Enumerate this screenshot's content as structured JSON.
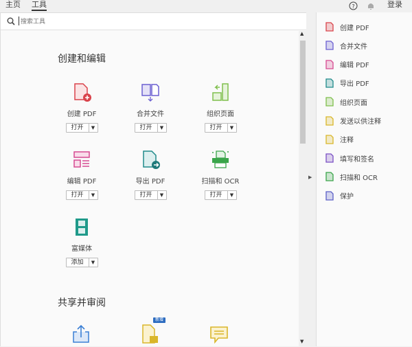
{
  "topbar": {
    "tabs": [
      {
        "label": "主页"
      },
      {
        "label": "工具"
      }
    ],
    "login": "登录"
  },
  "search": {
    "placeholder": "搜索工具"
  },
  "sections": [
    {
      "title": "创建和编辑",
      "tools": [
        {
          "label": "创建 PDF",
          "button": "打开",
          "color": "#d9434b"
        },
        {
          "label": "合并文件",
          "button": "打开",
          "color": "#6b5fd1"
        },
        {
          "label": "组织页面",
          "button": "打开",
          "color": "#7fbf4d"
        },
        {
          "label": "编辑 PDF",
          "button": "打开",
          "color": "#d64a91"
        },
        {
          "label": "导出 PDF",
          "button": "打开",
          "color": "#1f8a8a"
        },
        {
          "label": "扫描和 OCR",
          "button": "打开",
          "color": "#3aa54a"
        },
        {
          "label": "富媒体",
          "button": "添加",
          "color": "#1f9a8a"
        }
      ]
    },
    {
      "title": "共享并审阅",
      "badge": "新增",
      "tools": [
        {
          "color": "#3a7fd5"
        },
        {
          "color": "#d9b62a"
        },
        {
          "color": "#d9b62a"
        }
      ]
    }
  ],
  "sidebar": {
    "items": [
      {
        "label": "创建 PDF",
        "color": "#d9434b"
      },
      {
        "label": "合并文件",
        "color": "#6b5fd1"
      },
      {
        "label": "编辑 PDF",
        "color": "#d64a91"
      },
      {
        "label": "导出 PDF",
        "color": "#1f8a8a"
      },
      {
        "label": "组织页面",
        "color": "#7fbf4d"
      },
      {
        "label": "发送以供注释",
        "color": "#d9b62a"
      },
      {
        "label": "注释",
        "color": "#d9b62a"
      },
      {
        "label": "填写和签名",
        "color": "#7a4fc4"
      },
      {
        "label": "扫描和 OCR",
        "color": "#3aa54a"
      },
      {
        "label": "保护",
        "color": "#5b5fc7"
      }
    ]
  }
}
